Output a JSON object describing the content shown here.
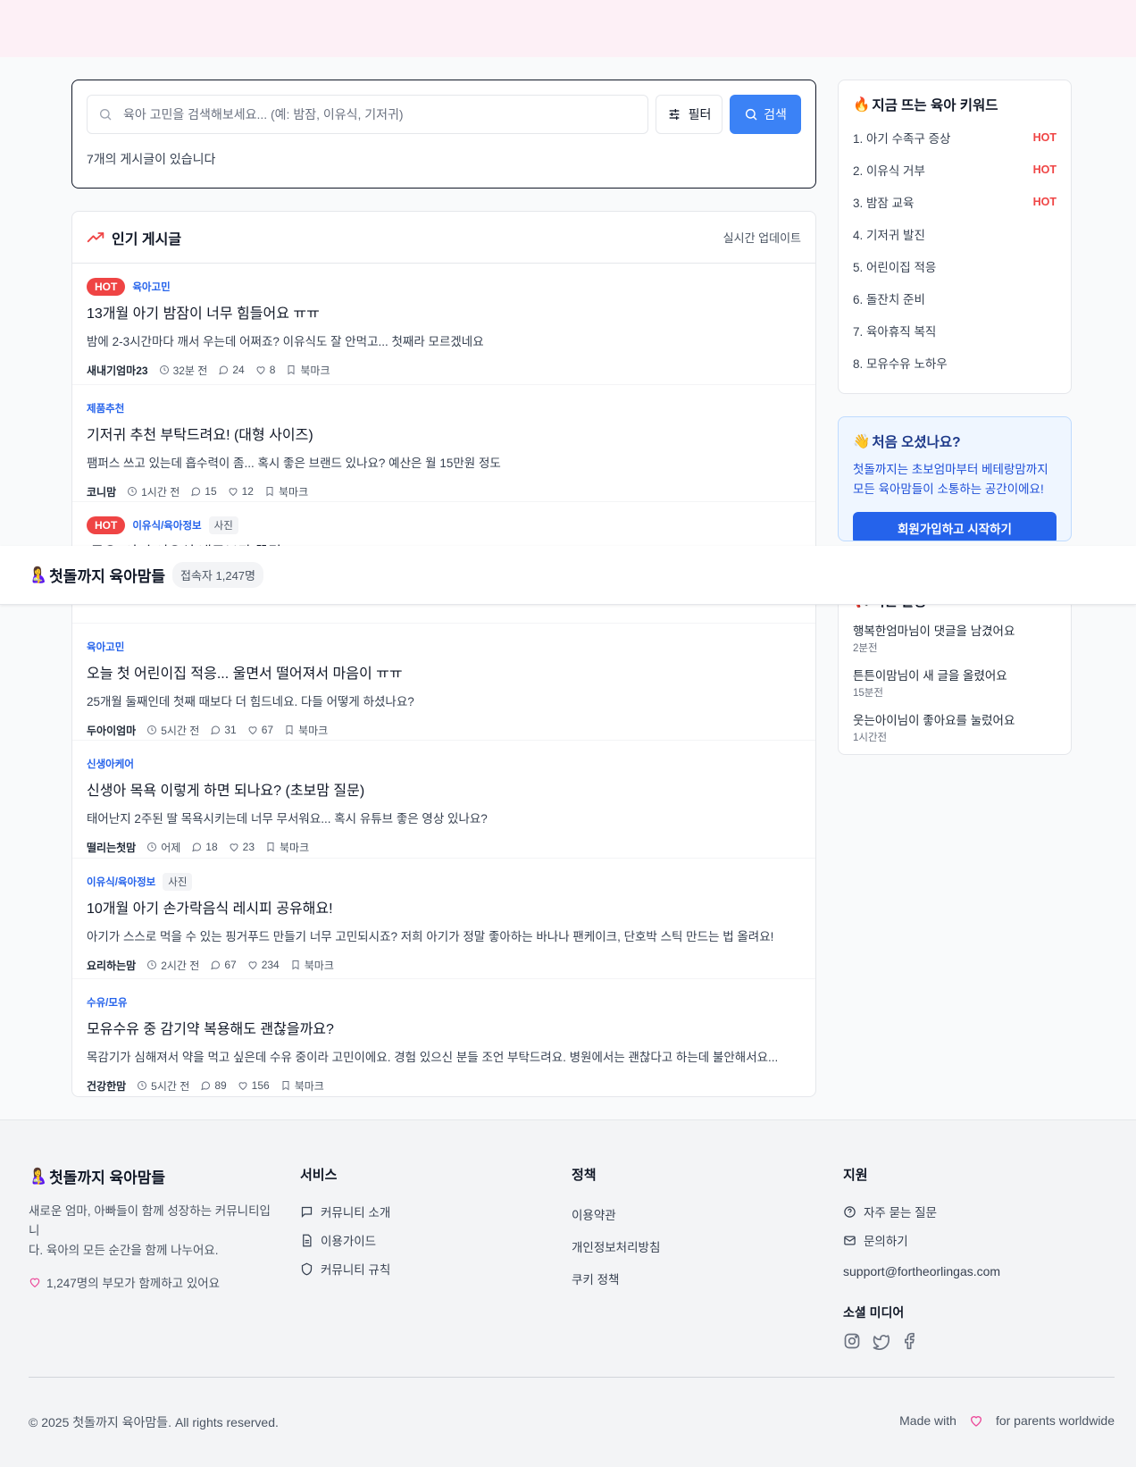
{
  "search": {
    "placeholder": "육아 고민을 검색해보세요... (예: 밤잠, 이유식, 기저귀)",
    "filter_label": "필터",
    "search_label": "검색",
    "post_count": "7개의 게시글이 있습니다"
  },
  "posts_section": {
    "title": "인기 게시글",
    "realtime": "실시간 업데이트",
    "bookmark_label": "북마크",
    "posts": [
      {
        "hot": "HOT",
        "category": "육아고민",
        "photo": "",
        "title": "13개월 아기 밤잠이 너무 힘들어요 ㅠㅠ",
        "body": "밤에 2-3시간마다 깨서 우는데 어쩌죠? 이유식도 잘 안먹고... 첫째라 모르겠네요",
        "author": "새내기엄마23",
        "time": "32분 전",
        "comments": "24",
        "likes": "8"
      },
      {
        "hot": "",
        "category": "제품추천",
        "photo": "",
        "title": "기저귀 추천 부탁드려요! (대형 사이즈)",
        "body": "팸퍼스 쓰고 있는데 흡수력이 좀... 혹시 좋은 브랜드 있나요? 예산은 월 15만원 정도",
        "author": "코니맘",
        "time": "1시간 전",
        "comments": "15",
        "likes": "12"
      },
      {
        "hot": "HOT",
        "category": "이유식/육아정보",
        "photo": "사진",
        "title": "[공유] 아기 이유식 냉동보관 꿀팁!",
        "body": "",
        "author": "",
        "time": "",
        "comments": "",
        "likes": ""
      },
      {
        "hot": "",
        "category": "육아고민",
        "photo": "",
        "title": "오늘 첫 어린이집 적응... 울면서 떨어져서 마음이 ㅠㅠ",
        "body": "25개월 둘째인데 첫째 때보다 더 힘드네요. 다들 어떻게 하셨나요?",
        "author": "두아이엄마",
        "time": "5시간 전",
        "comments": "31",
        "likes": "67"
      },
      {
        "hot": "",
        "category": "신생아케어",
        "photo": "",
        "title": "신생아 목욕 이렇게 하면 되나요? (초보맘 질문)",
        "body": "태어난지 2주된 딸 목욕시키는데 너무 무서워요... 혹시 유튜브 좋은 영상 있나요?",
        "author": "떨리는첫맘",
        "time": "어제",
        "comments": "18",
        "likes": "23"
      },
      {
        "hot": "",
        "category": "이유식/육아정보",
        "photo": "사진",
        "title": "10개월 아기 손가락음식 레시피 공유해요!",
        "body": "아기가 스스로 먹을 수 있는 핑거푸드 만들기 너무 고민되시죠? 저희 아기가 정말 좋아하는 바나나 팬케이크, 단호박 스틱 만드는 법 올려요!",
        "author": "요리하는맘",
        "time": "2시간 전",
        "comments": "67",
        "likes": "234"
      },
      {
        "hot": "",
        "category": "수유/모유",
        "photo": "",
        "title": "모유수유 중 감기약 복용해도 괜찮을까요?",
        "body": "목감기가 심해져서 약을 먹고 싶은데 수유 중이라 고민이에요. 경험 있으신 분들 조언 부탁드려요. 병원에서는 괜찮다고 하는데 불안해서요...",
        "author": "건강한맘",
        "time": "5시간 전",
        "comments": "89",
        "likes": "156"
      }
    ]
  },
  "keywords": {
    "title": "지금 뜨는 육아 키워드",
    "items": [
      {
        "label": "1. 아기 수족구 증상",
        "hot": "HOT"
      },
      {
        "label": "2. 이유식 거부",
        "hot": "HOT"
      },
      {
        "label": "3. 밤잠 교육",
        "hot": "HOT"
      },
      {
        "label": "4. 기저귀 발진",
        "hot": ""
      },
      {
        "label": "5. 어린이집 적응",
        "hot": ""
      },
      {
        "label": "6. 돌잔치 준비",
        "hot": ""
      },
      {
        "label": "7. 육아휴직 복직",
        "hot": ""
      },
      {
        "label": "8. 모유수유 노하우",
        "hot": ""
      }
    ]
  },
  "welcome": {
    "title": "처음 오셨나요?",
    "line1": "첫돌까지는 초보엄마부터 베테랑맘까지",
    "line2": "모든 육아맘들이 소통하는 공간이에요!",
    "join_label": "회원가입하고 시작하기"
  },
  "activity": {
    "title": "최근 활동",
    "items": [
      {
        "text": "행복한엄마님이 댓글을 남겼어요",
        "time": "2분전"
      },
      {
        "text": "튼튼이맘님이 새 글을 올렸어요",
        "time": "15분전"
      },
      {
        "text": "웃는아이님이 좋아요를 눌렀어요",
        "time": "1시간전"
      }
    ]
  },
  "header": {
    "brand": "첫돌까지 육아맘들",
    "visitors": "접속자 1,247명"
  },
  "footer": {
    "brand": "첫돌까지 육아맘들",
    "desc_line1": "새로운 엄마, 아빠들이 함께 성장하는 커뮤니티입니",
    "desc_line2": "다. 육아의 모든 순간을 함께 나누어요.",
    "parents": "1,247명의 부모가 함께하고 있어요",
    "service_title": "서비스",
    "service_links": [
      "커뮤니티 소개",
      "이용가이드",
      "커뮤니티 규칙"
    ],
    "policy_title": "정책",
    "policy_links": [
      "이용약관",
      "개인정보처리방침",
      "쿠키 정책"
    ],
    "support_title": "지원",
    "support_links": [
      "자주 묻는 질문",
      "문의하기"
    ],
    "email": "support@fortheorlingas.com",
    "social_title": "소셜 미디어",
    "copyright": "© 2025 첫돌까지 육아맘들. All rights reserved.",
    "made_with": "Made with",
    "for_parents": "for parents worldwide"
  },
  "colors": {
    "accent": "#3b82f6",
    "hot": "#ef4444",
    "category": "#2563eb",
    "join": "#2563eb",
    "heart": "#ec4899"
  }
}
